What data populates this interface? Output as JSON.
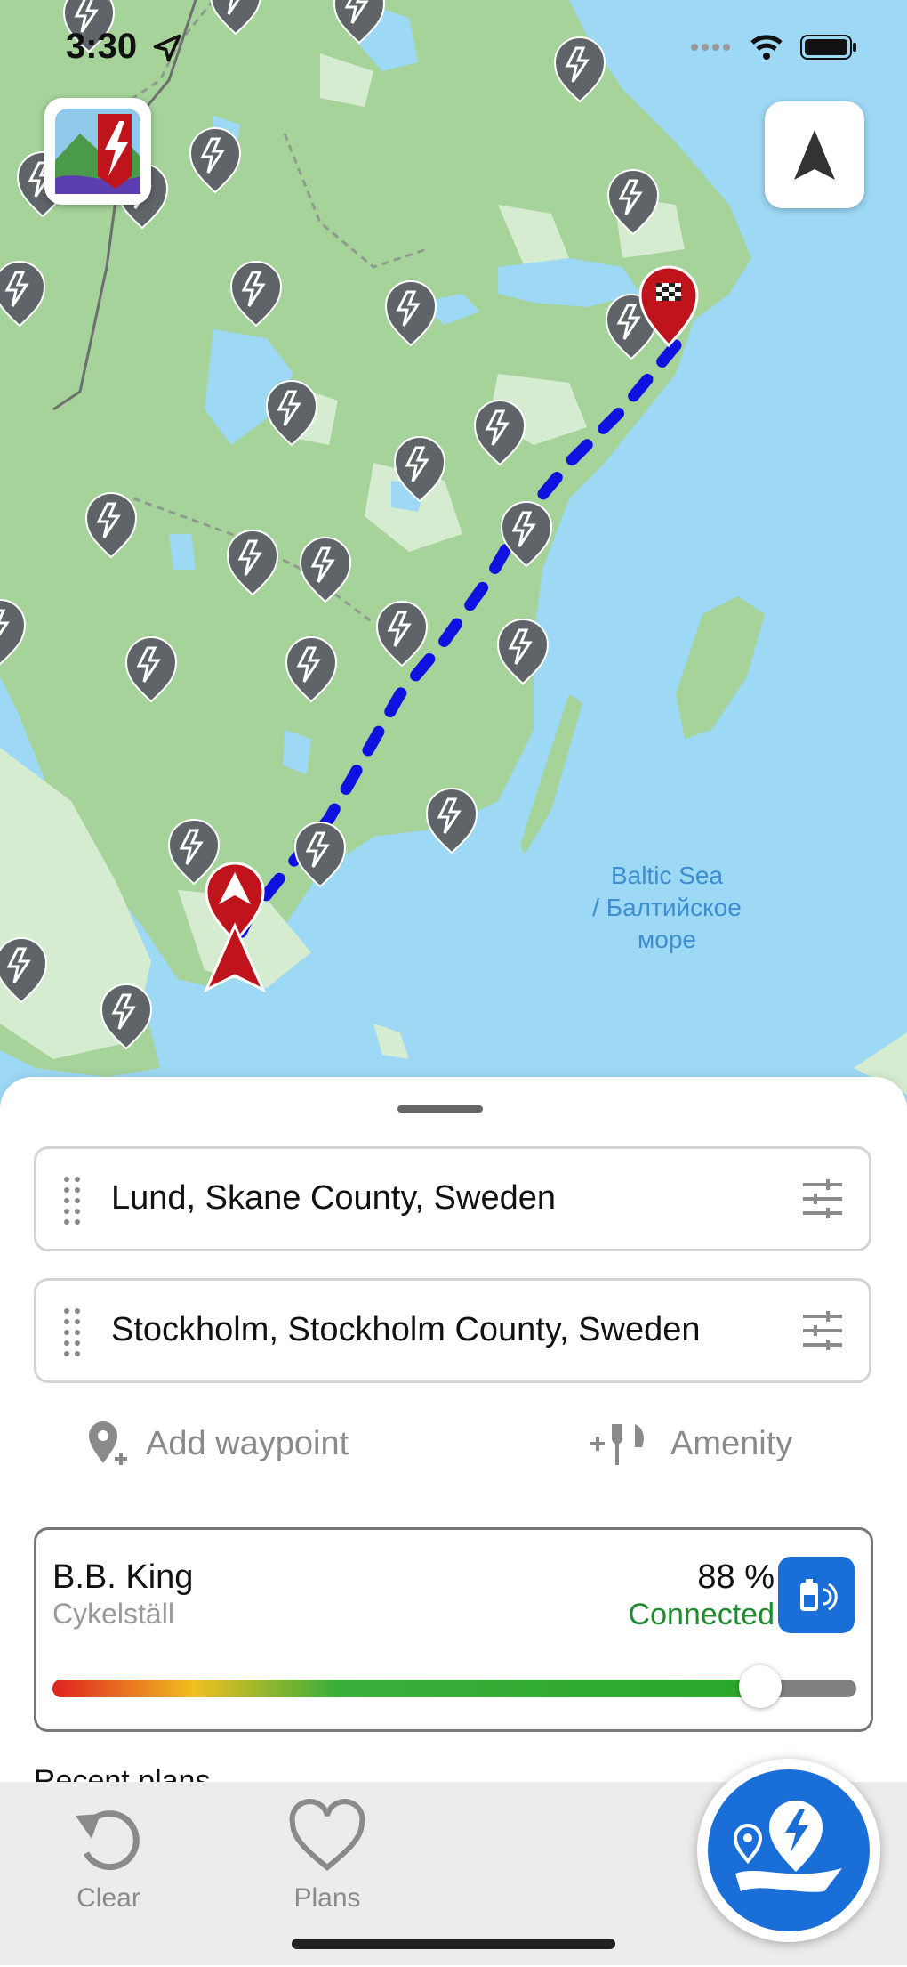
{
  "status": {
    "time": "3:30"
  },
  "map": {
    "sea_label_line1": "Baltic Sea",
    "sea_label_line2": "/ Балтийское",
    "sea_label_line3": "море",
    "route_color": "#1010e0",
    "pin_color": "#5f6468",
    "marker_color": "#c0141c"
  },
  "route": {
    "origin": "Lund, Skane County, Sweden",
    "destination": "Stockholm, Stockholm County, Sweden"
  },
  "actions": {
    "add_waypoint": "Add waypoint",
    "amenity": "Amenity"
  },
  "vehicle": {
    "name": "B.B. King",
    "subtitle": "Cykelställ",
    "battery": "88 %",
    "battery_level": 0.88,
    "status": "Connected"
  },
  "recent_plans_label": "Recent plans",
  "tabs": {
    "clear": "Clear",
    "plans": "Plans"
  },
  "colors": {
    "accent": "#1a6ed8",
    "connected": "#1f8a2e"
  }
}
